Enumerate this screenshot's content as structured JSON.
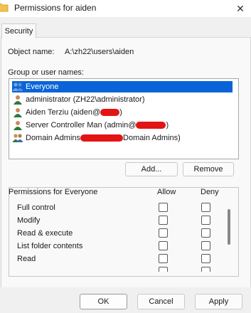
{
  "window": {
    "title": "Permissions for aiden",
    "close_symbol": "✕"
  },
  "tabs": [
    {
      "label": "Security"
    }
  ],
  "object": {
    "label": "Object name:",
    "value": "A:\\zh22\\users\\aiden"
  },
  "group_label": "Group or user names:",
  "users": [
    {
      "name": "Everyone",
      "icon": "group-icon",
      "selected": true
    },
    {
      "name": "administrator (ZH22\\administrator)",
      "icon": "user-icon",
      "selected": false
    },
    {
      "name_prefix": "Aiden Terziu (aiden@",
      "name_suffix": ")",
      "icon": "user-icon",
      "redacted": true
    },
    {
      "name_prefix": "Server Controller Man (admin@",
      "name_suffix": ")",
      "icon": "user-icon",
      "redacted": true
    },
    {
      "name_prefix": "Domain Admins ",
      "name_suffix": "Domain Admins)",
      "icon": "group-icon",
      "redacted": true
    }
  ],
  "buttons": {
    "add": "Add...",
    "remove": "Remove",
    "ok": "OK",
    "cancel": "Cancel",
    "apply": "Apply"
  },
  "permissions": {
    "header": "Permissions for Everyone",
    "allow_header": "Allow",
    "deny_header": "Deny",
    "rows": [
      {
        "name": "Full control",
        "allow": false,
        "deny": false
      },
      {
        "name": "Modify",
        "allow": false,
        "deny": false
      },
      {
        "name": "Read & execute",
        "allow": false,
        "deny": false
      },
      {
        "name": "List folder contents",
        "allow": false,
        "deny": false
      },
      {
        "name": "Read",
        "allow": false,
        "deny": false
      }
    ]
  },
  "colors": {
    "selection": "#0a64d8",
    "redaction": "#e21414",
    "folder": "#f2c14e"
  }
}
